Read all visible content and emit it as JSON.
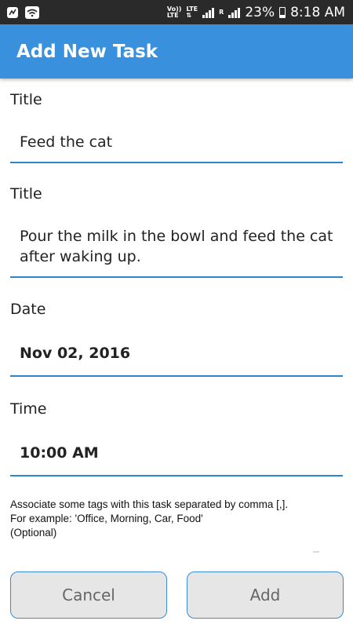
{
  "status_bar": {
    "network_top": "Vo))",
    "network_bottom": "LTE",
    "lte_label": "LTE",
    "roaming_label": "R",
    "battery": "23%",
    "time": "8:18 AM"
  },
  "app_bar": {
    "title": "Add New Task"
  },
  "form": {
    "title_label": "Title",
    "title_value": "Feed the cat",
    "description_label": "Title",
    "description_value": "Pour the milk in the bowl and feed the cat after waking up.",
    "date_label": "Date",
    "date_value": "Nov 02, 2016",
    "time_label": "Time",
    "time_value": "10:00 AM",
    "tags_hint_line1": "Associate some tags with this task separated by comma [,].",
    "tags_hint_line2": "For example: 'Office, Morning, Car, Food'",
    "tags_hint_line3": "(Optional)",
    "tags_value": ""
  },
  "buttons": {
    "cancel": "Cancel",
    "add": "Add"
  },
  "colors": {
    "accent": "#3991dd",
    "underline": "#2b86d0",
    "status_bar": "#2a2a2a",
    "button_bg": "#e6e6e6"
  }
}
